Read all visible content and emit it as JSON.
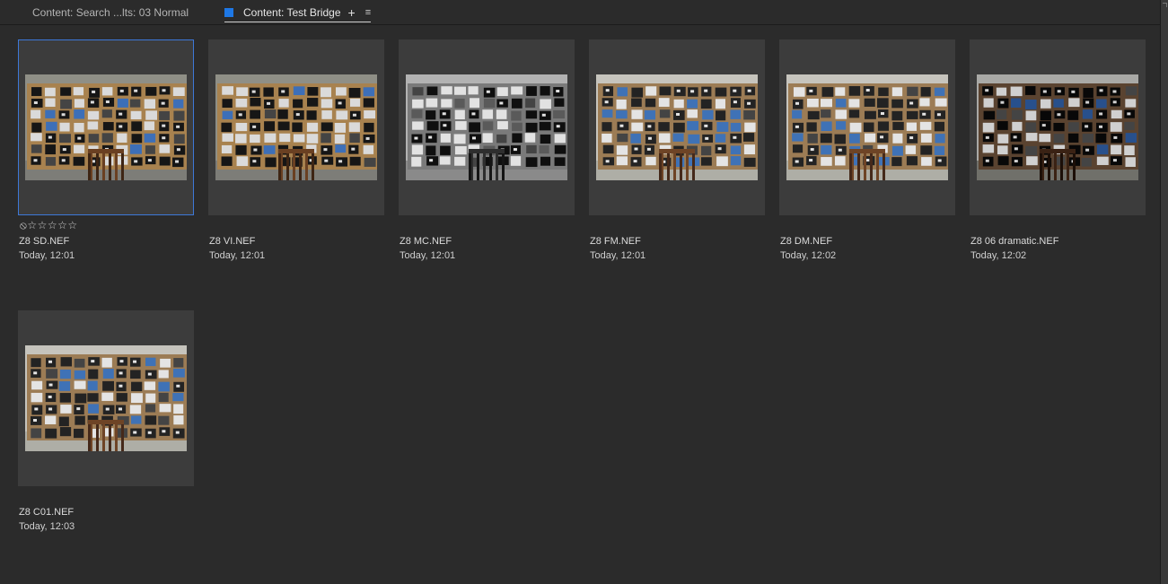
{
  "tabs": [
    {
      "label": "Content: Search ...lts: 03 Normal"
    },
    {
      "label": "Content: Test Bridge"
    }
  ],
  "tab_add_icon": "+",
  "tab_menu_icon": "≡",
  "items": [
    {
      "name": "Z8 SD.NEF",
      "date": "Today, 12:01",
      "selected": true,
      "rating": "⦸☆☆☆☆☆",
      "tone": "color"
    },
    {
      "name": "Z8 VI.NEF",
      "date": "Today, 12:01",
      "tone": "color"
    },
    {
      "name": "Z8 MC.NEF",
      "date": "Today, 12:01",
      "tone": "mono"
    },
    {
      "name": "Z8 FM.NEF",
      "date": "Today, 12:01",
      "tone": "flat"
    },
    {
      "name": "Z8 DM.NEF",
      "date": "Today, 12:02",
      "tone": "flat"
    },
    {
      "name": "Z8 06 dramatic.NEF",
      "date": "Today, 12:02",
      "tone": "dramatic"
    },
    {
      "name": "Z8 C01.NEF",
      "date": "Today, 12:03",
      "tone": "flat"
    }
  ],
  "colors": {
    "background": "#2b2b2b",
    "thumb_background": "#3c3c3c",
    "selection_border": "#3d78d8",
    "tab_accent": "#1e78e6"
  }
}
